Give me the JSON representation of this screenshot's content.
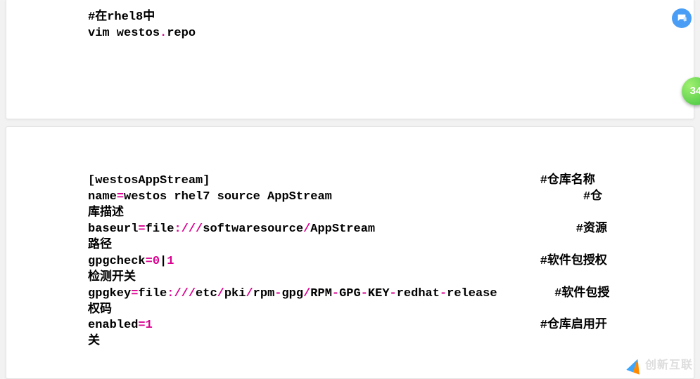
{
  "side_badge": "34",
  "logo_text": "创新互联",
  "block1": {
    "comment1": "#在rhel8中",
    "line1_a": "vim westos",
    "line1_b": ".",
    "line1_c": "repo"
  },
  "block2": {
    "l1_a": "[westosAppStream]",
    "l1_pad": "                                              ",
    "l1_b": "#仓库名称",
    "l2_a": "name",
    "eq": "=",
    "l2_b": "westos rhel7 source AppStream",
    "l2_pad": "                                   ",
    "l2_c": "#仓库描述",
    "l3_a": "baseurl",
    "l3_b": "file",
    "colon": ":",
    "slash": "/",
    "l3_c": "softwaresource",
    "l3_d": "AppStream",
    "l3_pad": "                            ",
    "l3_e": "#资源路径",
    "l4_a": "gpgcheck",
    "l4_b": "0",
    "pipe": "|",
    "l4_c": "1",
    "l4_pad": "                                                   ",
    "l4_d": "#软件包授权检测开关",
    "l5_a": "gpgkey",
    "l5_b": "file",
    "l5_c": "etc",
    "l5_d": "pki",
    "l5_e": "rpm",
    "dash": "-",
    "l5_f": "gpg",
    "l5_g": "RPM",
    "l5_h": "GPG",
    "l5_i": "KEY",
    "l5_j": "redhat",
    "l5_k": "release",
    "l5_pad": "        ",
    "l5_l": "#软件包授权码",
    "l6_a": "enabled",
    "l6_b": "1",
    "l6_pad": "                                                      ",
    "l6_c": "#仓库启用开关"
  }
}
